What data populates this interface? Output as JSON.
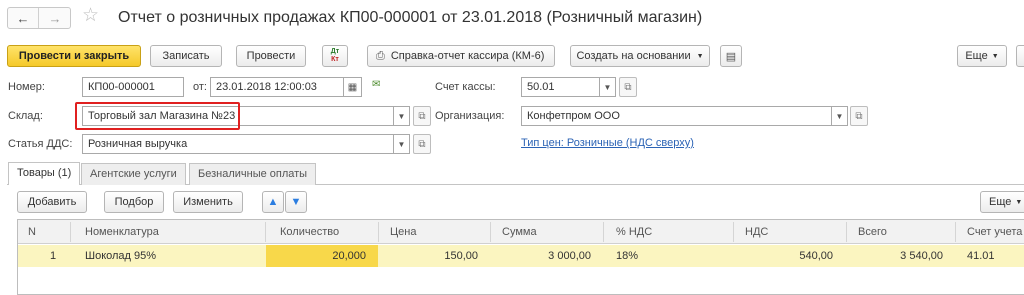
{
  "title": "Отчет о розничных продажах КП00-000001 от 23.01.2018 (Розничный магазин)",
  "nav": {
    "back_icon": "arrow-left",
    "forward_icon": "arrow-right",
    "favorite_icon": "star"
  },
  "toolbar": {
    "post_close": "Провести и закрыть",
    "save": "Записать",
    "post": "Провести",
    "dtkt_d": "Дт",
    "dtkt_k": "Кт",
    "cashier_report": "Справка-отчет кассира (КМ-6)",
    "create_based": "Создать на основании",
    "more": "Еще"
  },
  "form": {
    "number_label": "Номер:",
    "number_value": "КП00-000001",
    "date_label": "от:",
    "date_value": "23.01.2018 12:00:03",
    "cash_account_label": "Счет кассы:",
    "cash_account_value": "50.01",
    "warehouse_label": "Склад:",
    "warehouse_value": "Торговый зал Магазина №23",
    "organization_label": "Организация:",
    "organization_value": "Конфетпром ООО",
    "dds_label": "Статья ДДС:",
    "dds_value": "Розничная выручка",
    "price_type_link": "Тип цен: Розничные (НДС сверху)"
  },
  "tabs": [
    {
      "label": "Товары (1)",
      "active": true
    },
    {
      "label": "Агентские услуги",
      "active": false
    },
    {
      "label": "Безналичные оплаты",
      "active": false
    }
  ],
  "table_toolbar": {
    "add": "Добавить",
    "select": "Подбор",
    "change": "Изменить",
    "more": "Еще"
  },
  "table": {
    "columns": [
      "N",
      "Номенклатура",
      "Количество",
      "Цена",
      "Сумма",
      "% НДС",
      "НДС",
      "Всего",
      "Счет учета"
    ],
    "rows": [
      {
        "n": "1",
        "item": "Шоколад 95%",
        "qty": "20,000",
        "price": "150,00",
        "sum": "3 000,00",
        "vat_rate": "18%",
        "vat": "540,00",
        "total": "3 540,00",
        "account": "41.01"
      }
    ]
  },
  "colors": {
    "accent_yellow": "#f5c92a",
    "row_highlight": "#fbf5c0",
    "qty_cell": "#f8d84a",
    "highlight_border": "#e02020",
    "link": "#2b63b5"
  }
}
